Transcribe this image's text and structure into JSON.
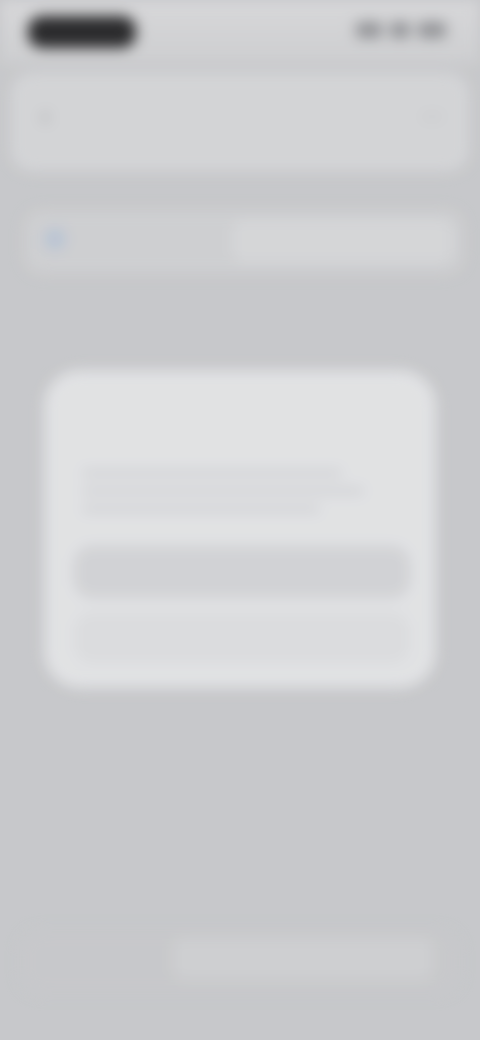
{
  "status_bar": {
    "time": ""
  },
  "header": {
    "title": "",
    "back_icon": "‹",
    "right_icon": "⋯"
  },
  "section": {
    "label": ""
  },
  "list_item": {
    "label": "",
    "value": ""
  },
  "dialog": {
    "title": "",
    "body": "",
    "primary_button": "",
    "secondary_button": ""
  },
  "footer": {
    "label": "",
    "input_value": ""
  },
  "colors": {
    "background": "#c8c9cc",
    "dialog": "#e4e5e7",
    "text_muted": "#8b8c90"
  },
  "icons": {
    "back": "chevron-left-icon",
    "menu": "more-icon"
  }
}
